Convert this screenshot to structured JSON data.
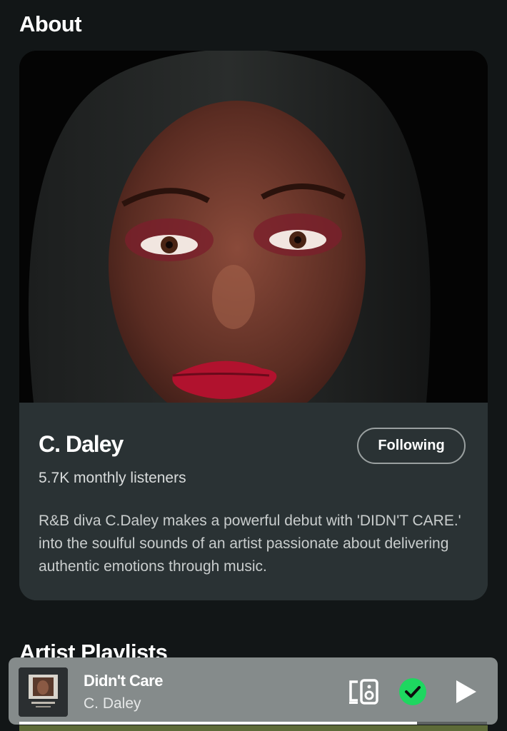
{
  "about": {
    "section_title": "About",
    "artist_name": "C. Daley",
    "monthly_listeners": "5.7K monthly listeners",
    "follow_label": "Following",
    "bio": "R&B diva C.Daley makes a powerful debut with 'DIDN'T CARE.' into the soulful sounds of an artist passionate about delivering authentic emotions through music."
  },
  "playlists": {
    "section_title": "Artist Playlists"
  },
  "now_playing": {
    "title": "Didn't Care",
    "artist": "C. Daley",
    "progress": 0.85,
    "icons": {
      "devices": "devices-icon",
      "liked": "check-circle-icon",
      "play": "play-icon"
    }
  },
  "colors": {
    "background": "#121617",
    "card": "#2a3234",
    "mini_player": "#858b8b",
    "accent_green": "#1ed760"
  }
}
